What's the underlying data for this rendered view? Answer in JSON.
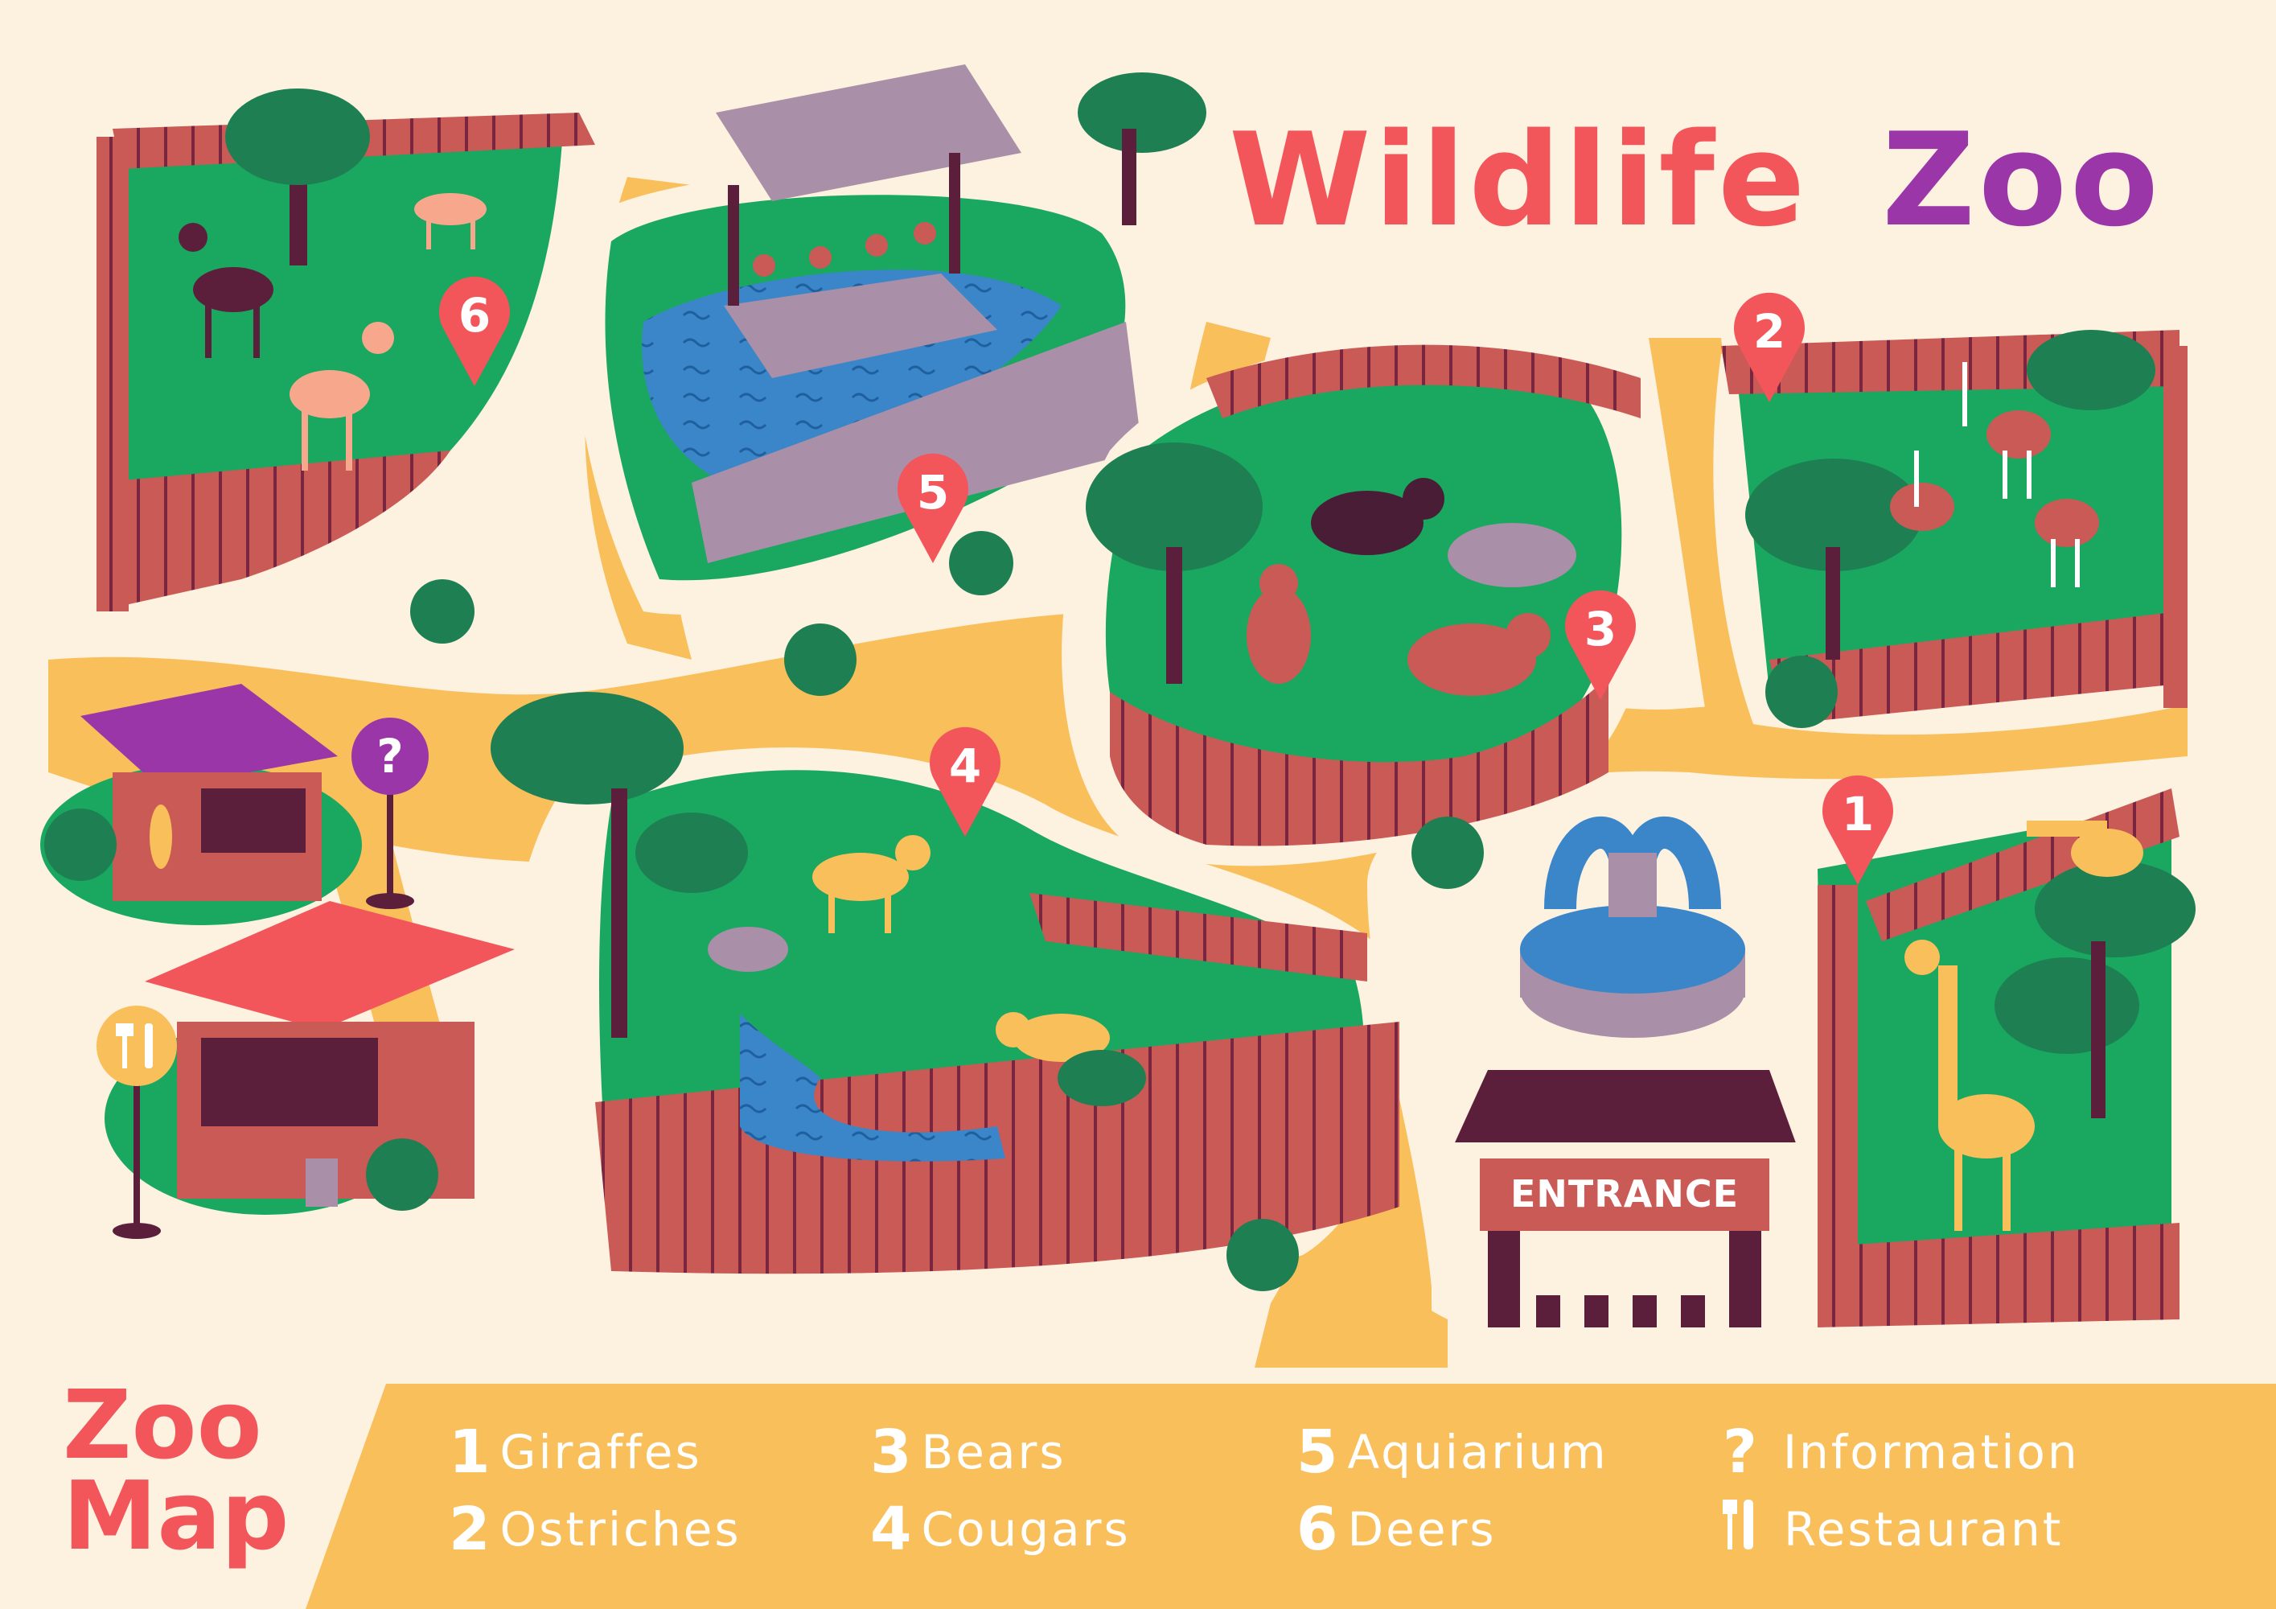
{
  "title": {
    "part1": "Wildlife",
    "part2": "Zoo"
  },
  "legend_title": {
    "line1": "Zoo",
    "line2": "Map"
  },
  "entrance_label": "ENTRANCE",
  "legend": [
    {
      "key": "1",
      "label": "Giraffes"
    },
    {
      "key": "2",
      "label": "Ostriches"
    },
    {
      "key": "3",
      "label": "Bears"
    },
    {
      "key": "4",
      "label": "Cougars"
    },
    {
      "key": "5",
      "label": "Aquiarium"
    },
    {
      "key": "6",
      "label": "Deers"
    },
    {
      "key": "?",
      "label": "Information"
    },
    {
      "key": "fork-knife-icon",
      "label": "Restaurant"
    }
  ],
  "markers": [
    {
      "label": "1"
    },
    {
      "label": "2"
    },
    {
      "label": "3"
    },
    {
      "label": "4"
    },
    {
      "label": "5"
    },
    {
      "label": "6"
    },
    {
      "label": "?"
    }
  ],
  "colors": {
    "background": "#fdf1e0",
    "path": "#f9bf5b",
    "grass": "#1aa760",
    "grass_light": "#2fbf6d",
    "fence": "#c95a55",
    "fence_dark": "#7a2640",
    "water": "#3a86c8",
    "marker": "#f2555a",
    "info_marker": "#9b36a8",
    "title_red": "#f2555a",
    "title_purple": "#9b36a8",
    "legend_band": "#f9bf5b"
  }
}
